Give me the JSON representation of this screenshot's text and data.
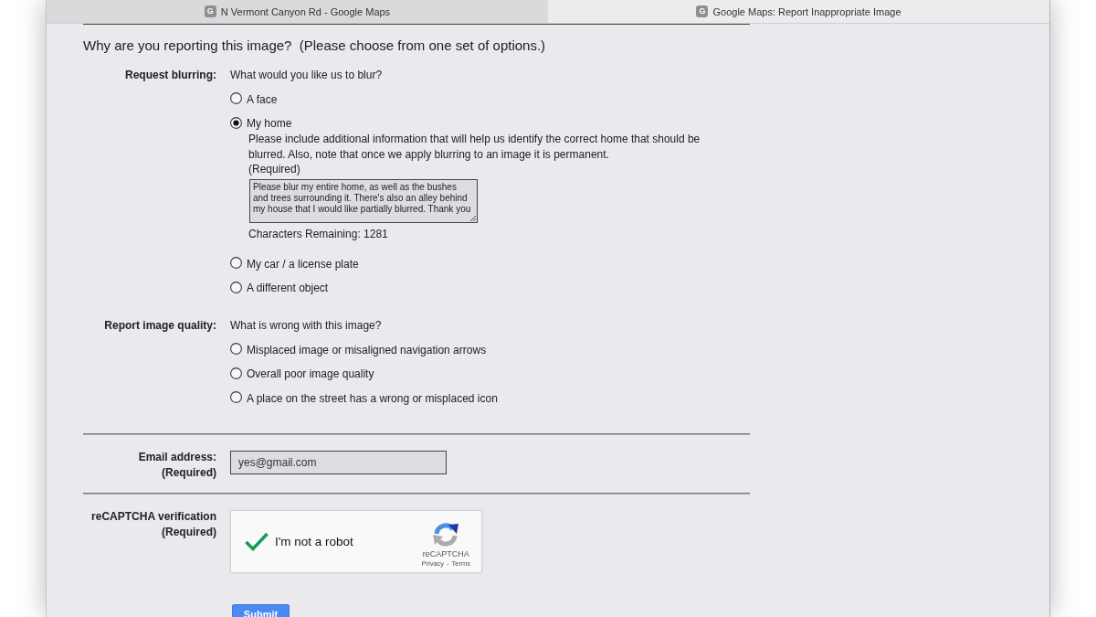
{
  "tabs": [
    {
      "favicon": "G",
      "title": "N Vermont Canyon Rd - Google Maps",
      "selected": false
    },
    {
      "favicon": "G",
      "title": "Google Maps: Report Inappropriate Image",
      "selected": true
    }
  ],
  "form": {
    "heading": "Why are you reporting this image?  (Please choose from one set of options.)",
    "groups": [
      {
        "label": "Request blurring:",
        "prompt": "What would you like us to blur?",
        "options": [
          {
            "label": "A face",
            "selected": false
          },
          {
            "label": "My home",
            "selected": true,
            "details": {
              "note": "Please include additional information that will help us identify the correct home that should be blurred. Also, note that once we apply blurring to an image it is permanent.",
              "required": "(Required)",
              "comment": "Please blur my entire home, as well as the bushes and trees surrounding it. There's also an alley behind my house that I would like partially blurred. Thank you",
              "counter": "Characters Remaining: 1281"
            }
          },
          {
            "label": "My car / a license plate",
            "selected": false
          },
          {
            "label": "A different object",
            "selected": false
          }
        ]
      },
      {
        "label": "Report image quality:",
        "prompt": "What is wrong with this image?",
        "options": [
          {
            "label": "Misplaced image or misaligned navigation arrows",
            "selected": false
          },
          {
            "label": "Overall poor image quality",
            "selected": false
          },
          {
            "label": "A place on the street has a wrong or misplaced icon",
            "selected": false
          }
        ]
      }
    ],
    "email": {
      "label": "Email address:",
      "required": "(Required)",
      "value": "yes@gmail.com"
    },
    "captcha": {
      "label": "reCAPTCHA verification",
      "required": "(Required)",
      "checked": true,
      "text": "I'm not a robot",
      "brand": "reCAPTCHA",
      "links": [
        "Privacy",
        "Terms"
      ],
      "link_separator": "-"
    },
    "submit_button": "Submit"
  }
}
